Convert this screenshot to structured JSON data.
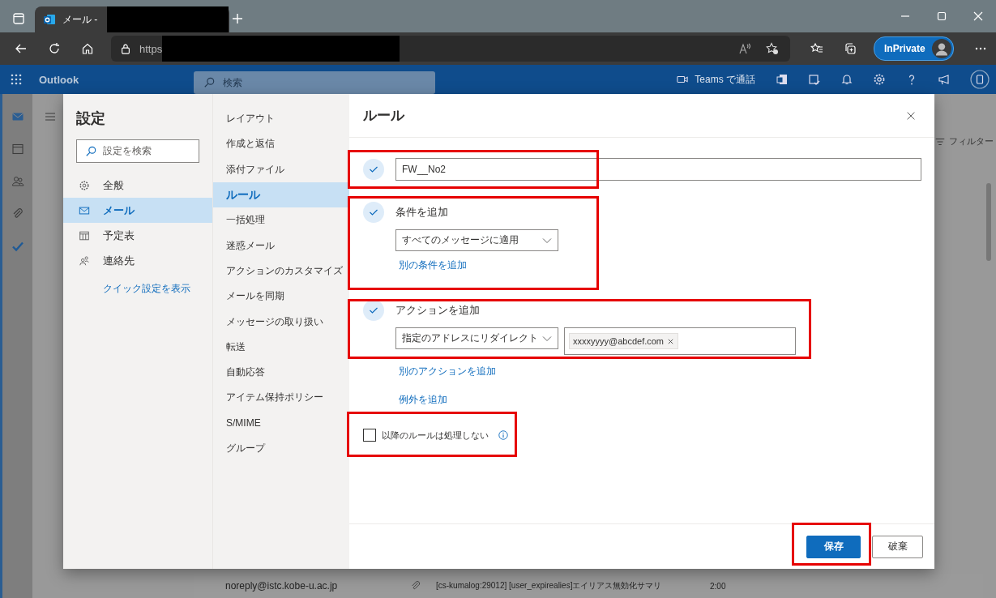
{
  "browser": {
    "tab_title": "メール -",
    "address": "https",
    "inprivate_label": "InPrivate"
  },
  "app": {
    "name": "Outlook",
    "search_placeholder": "検索",
    "teams_call": "Teams で通話"
  },
  "settings": {
    "title": "設定",
    "search_placeholder": "設定を検索",
    "categories": [
      {
        "label": "全般",
        "selected": false
      },
      {
        "label": "メール",
        "selected": true
      },
      {
        "label": "予定表",
        "selected": false
      },
      {
        "label": "連絡先",
        "selected": false
      }
    ],
    "quick_settings_link": "クイック設定を表示",
    "subcategories": [
      {
        "label": "レイアウト",
        "selected": false
      },
      {
        "label": "作成と返信",
        "selected": false
      },
      {
        "label": "添付ファイル",
        "selected": false
      },
      {
        "label": "ルール",
        "selected": true
      },
      {
        "label": "一括処理",
        "selected": false
      },
      {
        "label": "迷惑メール",
        "selected": false
      },
      {
        "label": "アクションのカスタマイズ",
        "selected": false
      },
      {
        "label": "メールを同期",
        "selected": false
      },
      {
        "label": "メッセージの取り扱い",
        "selected": false
      },
      {
        "label": "転送",
        "selected": false
      },
      {
        "label": "自動応答",
        "selected": false
      },
      {
        "label": "アイテム保持ポリシー",
        "selected": false
      },
      {
        "label": "S/MIME",
        "selected": false
      },
      {
        "label": "グループ",
        "selected": false
      }
    ]
  },
  "rule_editor": {
    "title": "ルール",
    "name": "FW__No2",
    "name_done": true,
    "condition": {
      "heading": "条件を追加",
      "done": true,
      "dropdown": "すべてのメッセージに適用",
      "add_link": "別の条件を追加"
    },
    "action": {
      "heading": "アクションを追加",
      "done": true,
      "dropdown": "指定のアドレスにリダイレクト",
      "recipients": [
        "xxxxyyyy@abcdef.com"
      ],
      "add_link": "別のアクションを追加"
    },
    "exception_link": "例外を追加",
    "stop_processing": {
      "label": "以降のルールは処理しない",
      "checked": false
    },
    "buttons": [
      {
        "label": "保存",
        "kind": "primary"
      },
      {
        "label": "破棄",
        "kind": "secondary"
      }
    ]
  },
  "background": {
    "filter_label": "フィルター",
    "message": {
      "sender": "noreply@istc.kobe-u.ac.jp",
      "subject": "[cs-kumalog:29012] [user_expirealies]エイリアス無効化サマリ",
      "time": "2:00"
    }
  }
}
